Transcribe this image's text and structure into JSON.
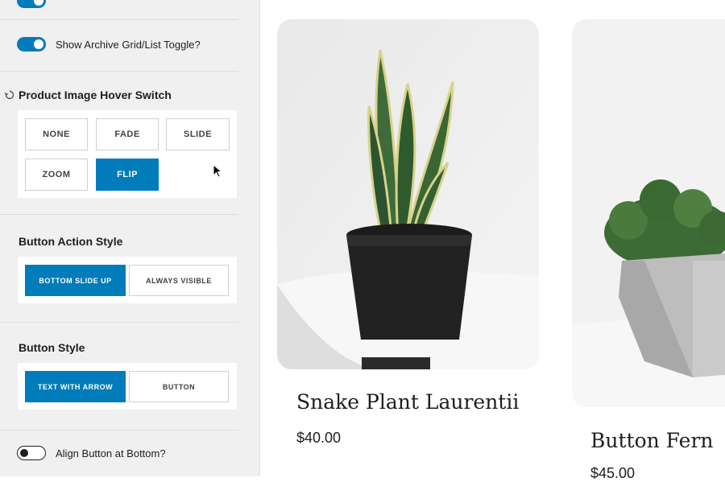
{
  "settings": {
    "archive_toggle": {
      "label": "Show Archive Grid/List Toggle?",
      "on": true
    },
    "hover_switch": {
      "title": "Product Image Hover Switch",
      "options": [
        "NONE",
        "FADE",
        "SLIDE",
        "ZOOM",
        "FLIP"
      ],
      "selected": "FLIP"
    },
    "button_action": {
      "title": "Button Action Style",
      "options": [
        "BOTTOM SLIDE UP",
        "ALWAYS VISIBLE"
      ],
      "selected": "BOTTOM SLIDE UP"
    },
    "button_style": {
      "title": "Button Style",
      "options": [
        "TEXT WITH ARROW",
        "BUTTON"
      ],
      "selected": "TEXT WITH ARROW"
    },
    "align_toggle": {
      "label": "Align Button at Bottom?",
      "on": false
    }
  },
  "products": [
    {
      "name": "Snake Plant Laurentii",
      "price": "$40.00"
    },
    {
      "name": "Button Fern",
      "price": "$45.00"
    }
  ],
  "colors": {
    "accent": "#007cba",
    "sidebar_bg": "#f0f0f0",
    "text": "#1e1e1e"
  }
}
